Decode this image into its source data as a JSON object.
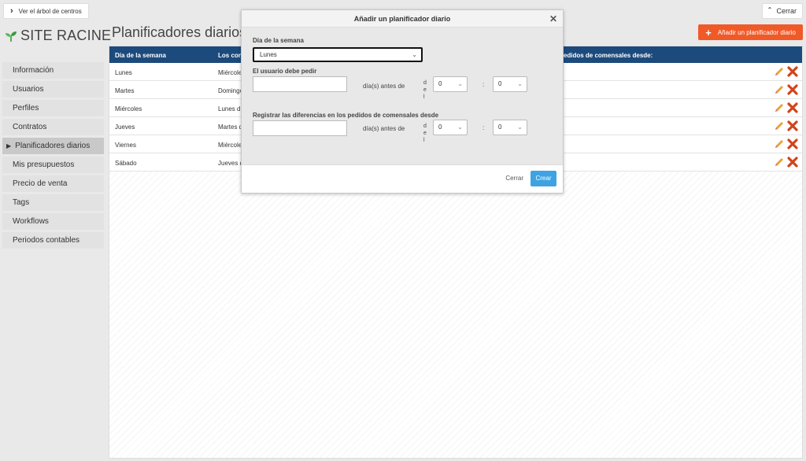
{
  "topbar": {
    "tree_label": "Ver el árbol de centros",
    "close_label": "Cerrar"
  },
  "logo": {
    "name": "SITE RACINE"
  },
  "page": {
    "title": "Planificadores diarios",
    "add_label": "Añadir un planificador diario"
  },
  "sidebar": {
    "items": [
      {
        "label": "Información"
      },
      {
        "label": "Usuarios"
      },
      {
        "label": "Perfiles"
      },
      {
        "label": "Contratos"
      },
      {
        "label": "Planificadores diarios",
        "active": true
      },
      {
        "label": "Mis presupuestos"
      },
      {
        "label": "Precio de venta"
      },
      {
        "label": "Tags"
      },
      {
        "label": "Workflows"
      },
      {
        "label": "Periodos contables"
      }
    ]
  },
  "table": {
    "headers": {
      "day": "Día de la semana",
      "users": "Los con",
      "diff": "pedidos de comensales desde:"
    },
    "rows": [
      {
        "day": "Lunes",
        "users": "Miércole"
      },
      {
        "day": "Martes",
        "users": "Domingo"
      },
      {
        "day": "Miércoles",
        "users": "Lunes d"
      },
      {
        "day": "Jueves",
        "users": "Martes d"
      },
      {
        "day": "Viernes",
        "users": "Miércole"
      },
      {
        "day": "Sábado",
        "users": "Jueves d"
      }
    ]
  },
  "modal": {
    "title": "Añadir un planificador diario",
    "day_label": "Día de la semana",
    "day_value": "Lunes",
    "order_label": "El usuario debe pedir",
    "diff_label": "Registrar las diferencias en los pedidos de comensales desde",
    "days_before": "día(s) antes de",
    "del_chars": [
      "d",
      "e",
      "l"
    ],
    "hour_value": "0",
    "minute_value": "0",
    "colon": ":",
    "cancel_label": "Cerrar",
    "create_label": "Crear"
  },
  "colors": {
    "header_blue": "#1c4a7c",
    "accent_orange": "#f05a28",
    "create_blue": "#3ea3e0",
    "logo_green": "#3a9b3a"
  }
}
